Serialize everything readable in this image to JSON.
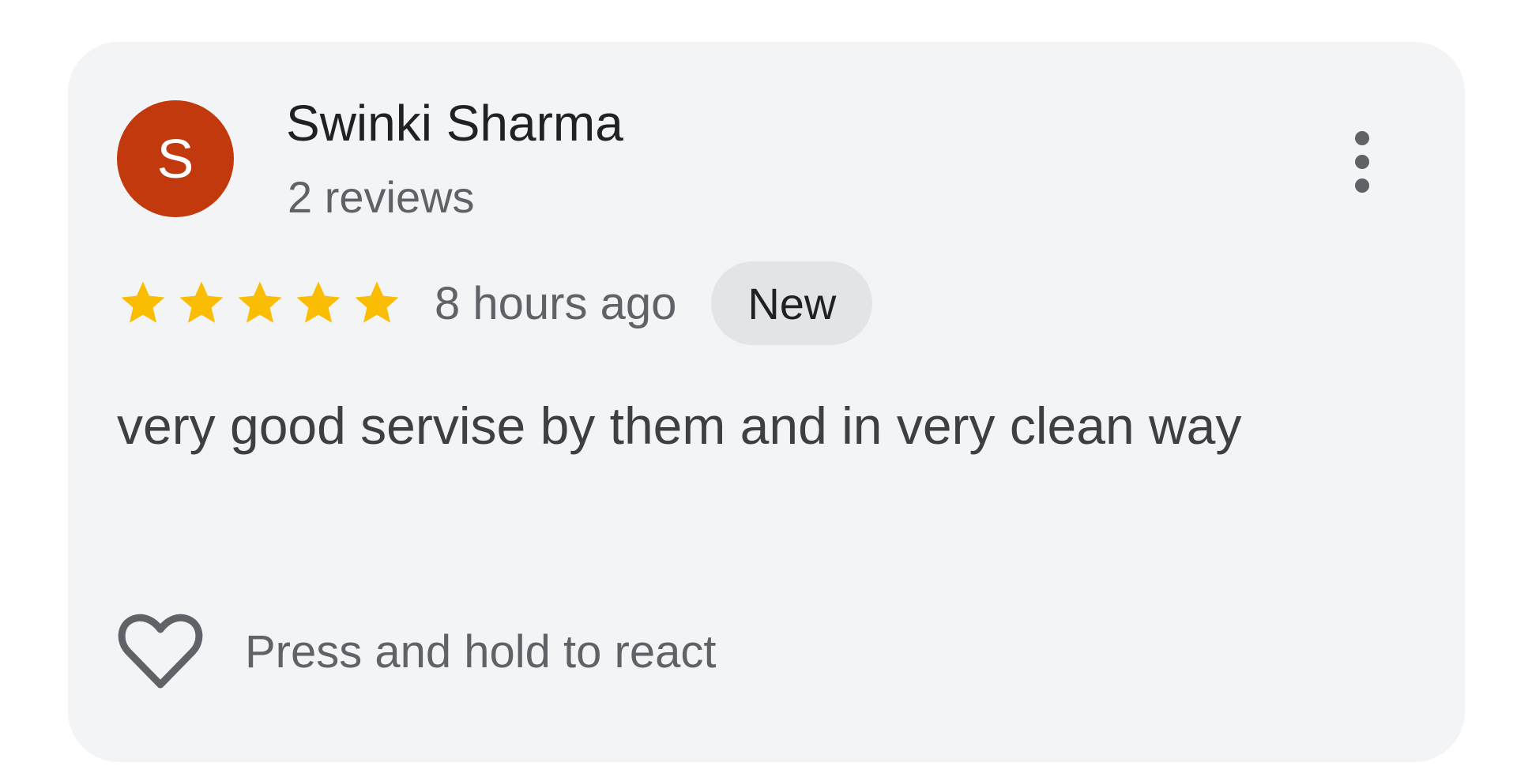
{
  "review": {
    "avatar_initial": "S",
    "avatar_color": "#c1390c",
    "author_name": "Swinki Sharma",
    "author_reviews": "2 reviews",
    "rating": 5,
    "rating_max": 5,
    "star_color": "#fbbc04",
    "time_ago": "8 hours ago",
    "badge": "New",
    "text": "very good servise by them and in very clean way",
    "react_label": "Press and hold to react",
    "icons": {
      "more": "more-vert-icon",
      "star": "star-icon",
      "react": "heart-outline-icon"
    }
  }
}
